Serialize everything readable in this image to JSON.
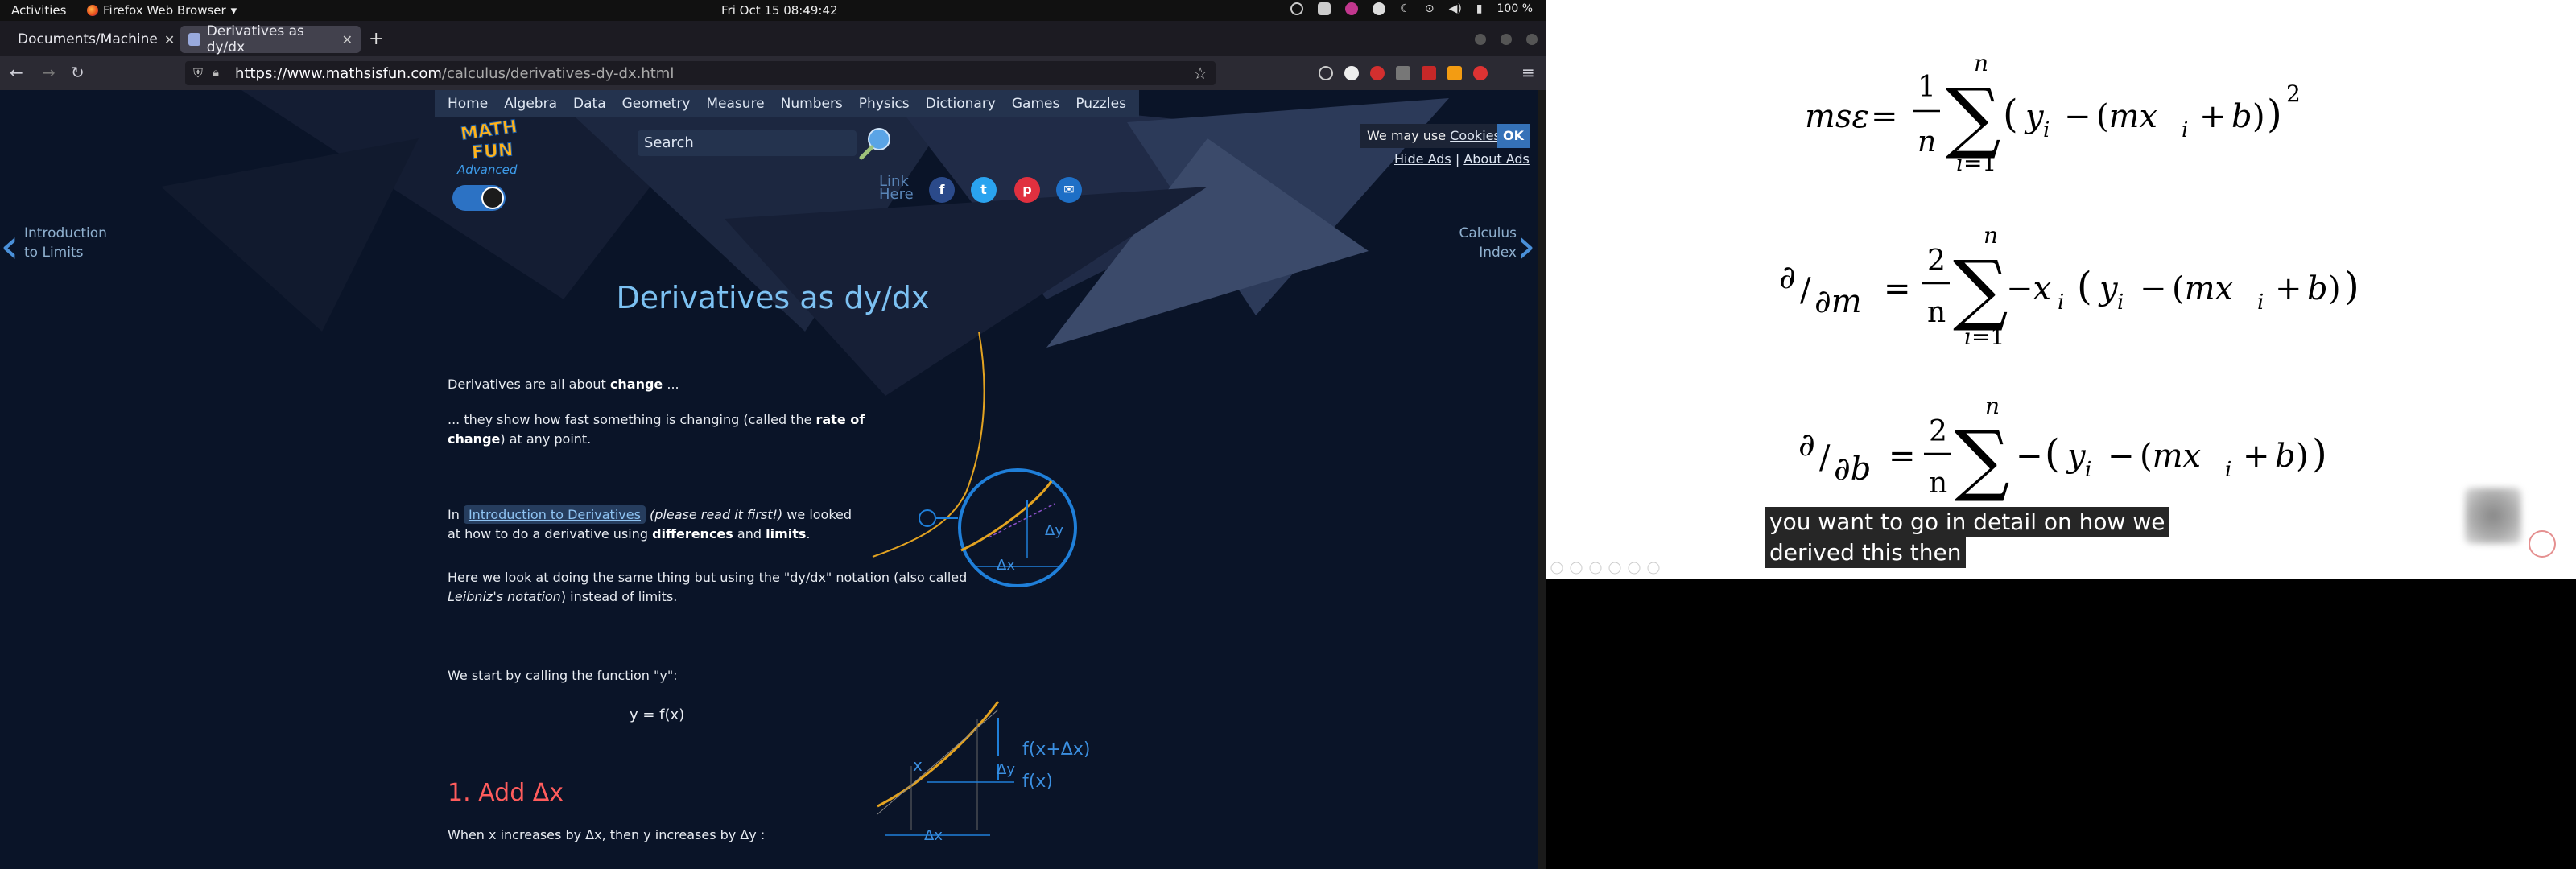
{
  "topbar": {
    "activities": "Activities",
    "app": "Firefox Web Browser",
    "clock": "Fri Oct 15  08:49:42",
    "battery": "100 %"
  },
  "browser": {
    "tabs": [
      {
        "title": "Documents/Machine"
      },
      {
        "title": "Derivatives as dy/dx"
      }
    ],
    "url_host": "https://www.mathsisfun.com",
    "url_path": "/calculus/derivatives-dy-dx.html"
  },
  "site": {
    "menu": [
      "Home",
      "Algebra",
      "Data",
      "Geometry",
      "Measure",
      "Numbers",
      "Physics",
      "Dictionary",
      "Games",
      "Puzzles"
    ],
    "logo": [
      "MATH",
      "FUN",
      "Advanced"
    ],
    "search_placeholder": "Search",
    "link_here": [
      "Link",
      "Here"
    ],
    "cookie_text": "We may use",
    "cookie_link": "Cookies",
    "cookie_ok": "OK",
    "hide_ads": "Hide Ads",
    "sep": "|",
    "about_ads": "About Ads",
    "prev_link": [
      "Introduction",
      "to Limits"
    ],
    "next_link": [
      "Calculus",
      "Index"
    ]
  },
  "article": {
    "title": "Derivatives as dy/dx",
    "p1_pre": "Derivatives are all about ",
    "p1_bold": "change",
    "p1_post": " ...",
    "p2_pre": "... they show how fast something is changing (called the ",
    "p2_bold": "rate of change",
    "p2_post": ") at any point.",
    "p3_pre": "In ",
    "p3_link": "Introduction to Derivatives",
    "p3_italic": "(please read it first!)",
    "p3_mid": " we looked at how to do a derivative using ",
    "p3_b1": "differences",
    "p3_and": " and ",
    "p3_b2": "limits",
    "p3_end": ".",
    "p4_pre": "Here we look at doing the same thing but using the \"dy/dx\" notation (also called ",
    "p4_italic": "Leibniz's notation",
    "p4_post": ") instead of limits.",
    "p5": "We start by calling the function \"y\":",
    "eq": "y = f(x)",
    "h1": "1. Add Δx",
    "p6": "When x increases by Δx, then y increases by Δy :",
    "diag1": {
      "dy": "Δy",
      "dx": "Δx"
    },
    "diag2": {
      "x": "x",
      "fxdx": "f(x+Δx)",
      "dy": "Δy",
      "fx": "f(x)",
      "dx": "Δx"
    }
  },
  "video": {
    "caption_line1": "you want to go in detail on how we",
    "caption_line2": "derived this then"
  }
}
